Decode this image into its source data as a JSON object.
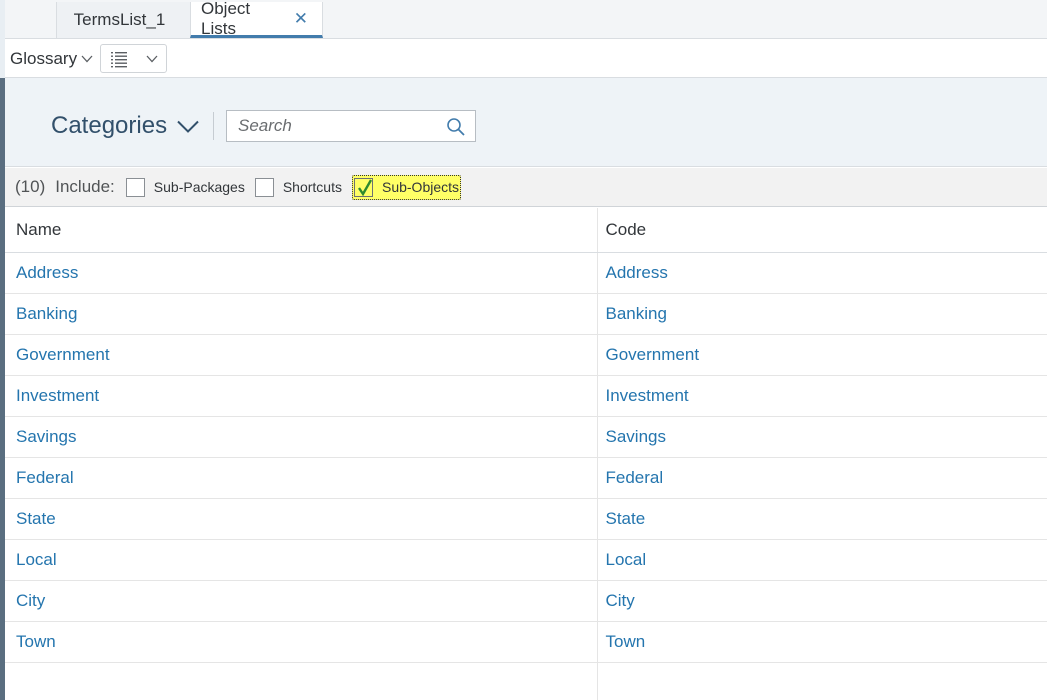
{
  "tabs": [
    {
      "label": "TermsList_1",
      "active": false
    },
    {
      "label": "Object Lists",
      "active": true,
      "closable": true
    }
  ],
  "toolbar": {
    "glossary_label": "Glossary",
    "view_icon": "list-view-icon"
  },
  "header": {
    "categories_label": "Categories",
    "search_placeholder": "Search"
  },
  "include_bar": {
    "count": "(10)",
    "include_label": "Include:",
    "options": [
      {
        "label": "Sub-Packages",
        "checked": false
      },
      {
        "label": "Shortcuts",
        "checked": false
      },
      {
        "label": "Sub-Objects",
        "checked": true
      }
    ]
  },
  "table": {
    "columns": [
      "Name",
      "Code"
    ],
    "rows": [
      {
        "name": "Address",
        "code": "Address"
      },
      {
        "name": "Banking",
        "code": "Banking"
      },
      {
        "name": "Government",
        "code": "Government"
      },
      {
        "name": "Investment",
        "code": "Investment"
      },
      {
        "name": "Savings",
        "code": "Savings"
      },
      {
        "name": "Federal",
        "code": "Federal"
      },
      {
        "name": "State",
        "code": "State"
      },
      {
        "name": "Local",
        "code": "Local"
      },
      {
        "name": "City",
        "code": "City"
      },
      {
        "name": "Town",
        "code": "Town"
      }
    ]
  },
  "colors": {
    "link": "#2475ae",
    "accent": "#427cac",
    "highlight": "#ffff66",
    "check": "#2e8b2e"
  }
}
